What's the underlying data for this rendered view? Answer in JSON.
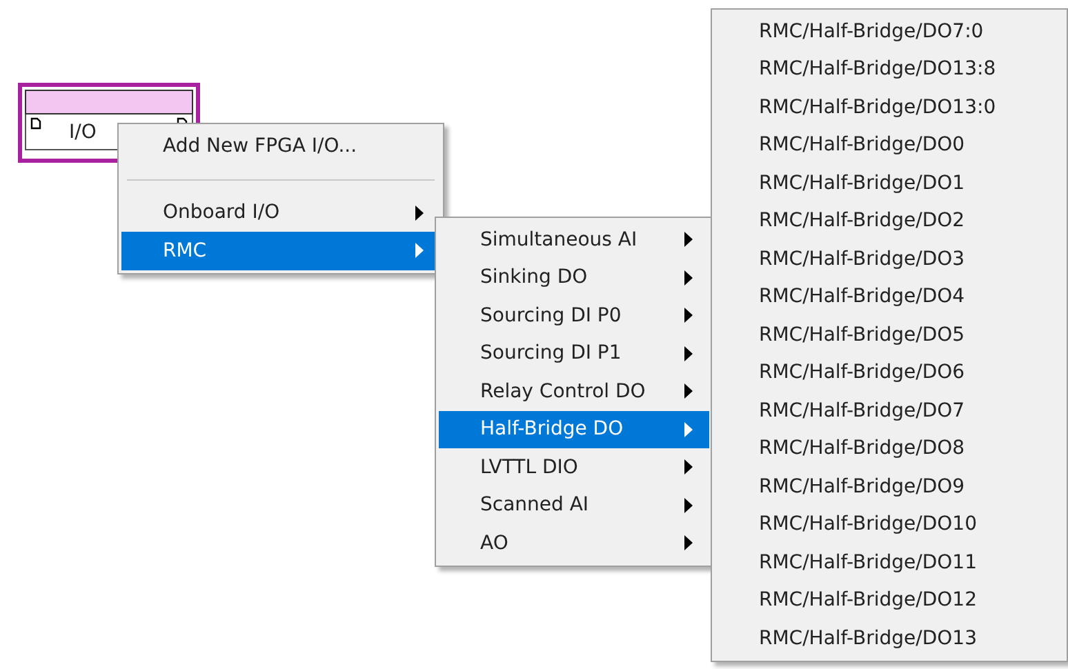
{
  "node": {
    "label": "I/O"
  },
  "menus": [
    {
      "items": [
        {
          "kind": "command",
          "label": "Add New FPGA I/O...",
          "selected": false
        },
        {
          "kind": "separator"
        },
        {
          "kind": "submenu",
          "label": "Onboard I/O",
          "selected": false
        },
        {
          "kind": "submenu",
          "label": "RMC",
          "selected": true
        }
      ]
    },
    {
      "items": [
        {
          "kind": "submenu",
          "label": "Simultaneous AI",
          "selected": false
        },
        {
          "kind": "submenu",
          "label": "Sinking DO",
          "selected": false
        },
        {
          "kind": "submenu",
          "label": "Sourcing DI P0",
          "selected": false
        },
        {
          "kind": "submenu",
          "label": "Sourcing DI P1",
          "selected": false
        },
        {
          "kind": "submenu",
          "label": "Relay Control DO",
          "selected": false
        },
        {
          "kind": "submenu",
          "label": "Half-Bridge DO",
          "selected": true
        },
        {
          "kind": "submenu",
          "label": "LVTTL DIO",
          "selected": false
        },
        {
          "kind": "submenu",
          "label": "Scanned AI",
          "selected": false
        },
        {
          "kind": "submenu",
          "label": "AO",
          "selected": false
        }
      ]
    },
    {
      "items": [
        {
          "kind": "command",
          "label": "RMC/Half-Bridge/DO7:0",
          "selected": false
        },
        {
          "kind": "command",
          "label": "RMC/Half-Bridge/DO13:8",
          "selected": false
        },
        {
          "kind": "command",
          "label": "RMC/Half-Bridge/DO13:0",
          "selected": false
        },
        {
          "kind": "command",
          "label": "RMC/Half-Bridge/DO0",
          "selected": false
        },
        {
          "kind": "command",
          "label": "RMC/Half-Bridge/DO1",
          "selected": false
        },
        {
          "kind": "command",
          "label": "RMC/Half-Bridge/DO2",
          "selected": false
        },
        {
          "kind": "command",
          "label": "RMC/Half-Bridge/DO3",
          "selected": false
        },
        {
          "kind": "command",
          "label": "RMC/Half-Bridge/DO4",
          "selected": false
        },
        {
          "kind": "command",
          "label": "RMC/Half-Bridge/DO5",
          "selected": false
        },
        {
          "kind": "command",
          "label": "RMC/Half-Bridge/DO6",
          "selected": false
        },
        {
          "kind": "command",
          "label": "RMC/Half-Bridge/DO7",
          "selected": false
        },
        {
          "kind": "command",
          "label": "RMC/Half-Bridge/DO8",
          "selected": false
        },
        {
          "kind": "command",
          "label": "RMC/Half-Bridge/DO9",
          "selected": false
        },
        {
          "kind": "command",
          "label": "RMC/Half-Bridge/DO10",
          "selected": false
        },
        {
          "kind": "command",
          "label": "RMC/Half-Bridge/DO11",
          "selected": false
        },
        {
          "kind": "command",
          "label": "RMC/Half-Bridge/DO12",
          "selected": false
        },
        {
          "kind": "command",
          "label": "RMC/Half-Bridge/DO13",
          "selected": false
        }
      ]
    }
  ]
}
